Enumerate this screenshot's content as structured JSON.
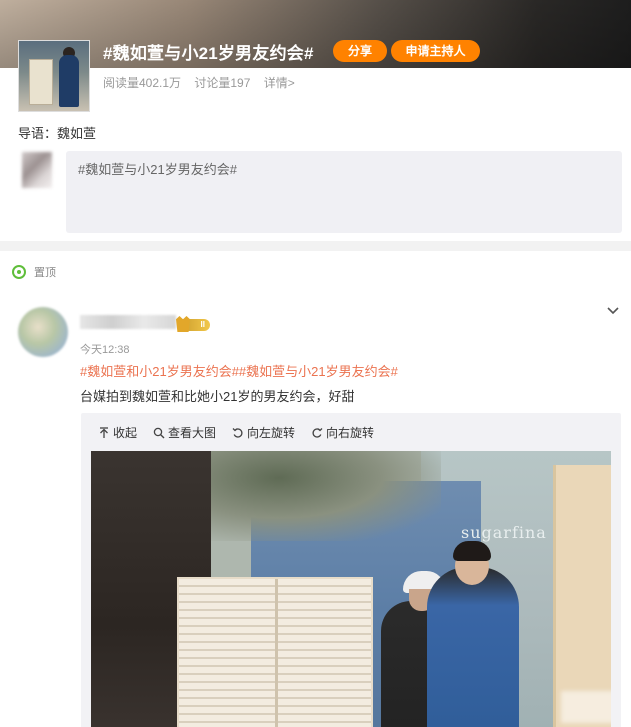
{
  "topic": {
    "title": "#魏如萱与小21岁男友约会#",
    "share_label": "分享",
    "host_label": "申请主持人",
    "reads": "阅读量402.1万",
    "discussions": "讨论量197",
    "details": "详情>"
  },
  "intro": {
    "text": "导语：魏如萱"
  },
  "compose": {
    "text": "#魏如萱与小21岁男友约会#"
  },
  "pinned": {
    "label": "置顶"
  },
  "post": {
    "time": "今天12:38",
    "badge": "II",
    "tags": "#魏如萱和小21岁男友约会##魏如萱与小21岁男友约会#",
    "text": "台媒拍到魏如萱和比她小21岁的男友约会，好甜",
    "toolbar": {
      "collapse": "收起",
      "view_large": "查看大图",
      "rotate_left": "向左旋转",
      "rotate_right": "向右旋转"
    },
    "photo_sign": "sugarfina"
  },
  "colors": {
    "accent_orange": "#ff8200",
    "tag_color": "#eb7350",
    "pin_green": "#5fbe3a"
  },
  "icons": {
    "pin": "pin-icon",
    "chevron": "chevron-down-icon",
    "collapse": "arrow-up-icon",
    "search": "search-icon",
    "rotate_left": "rotate-left-icon",
    "rotate_right": "rotate-right-icon"
  }
}
